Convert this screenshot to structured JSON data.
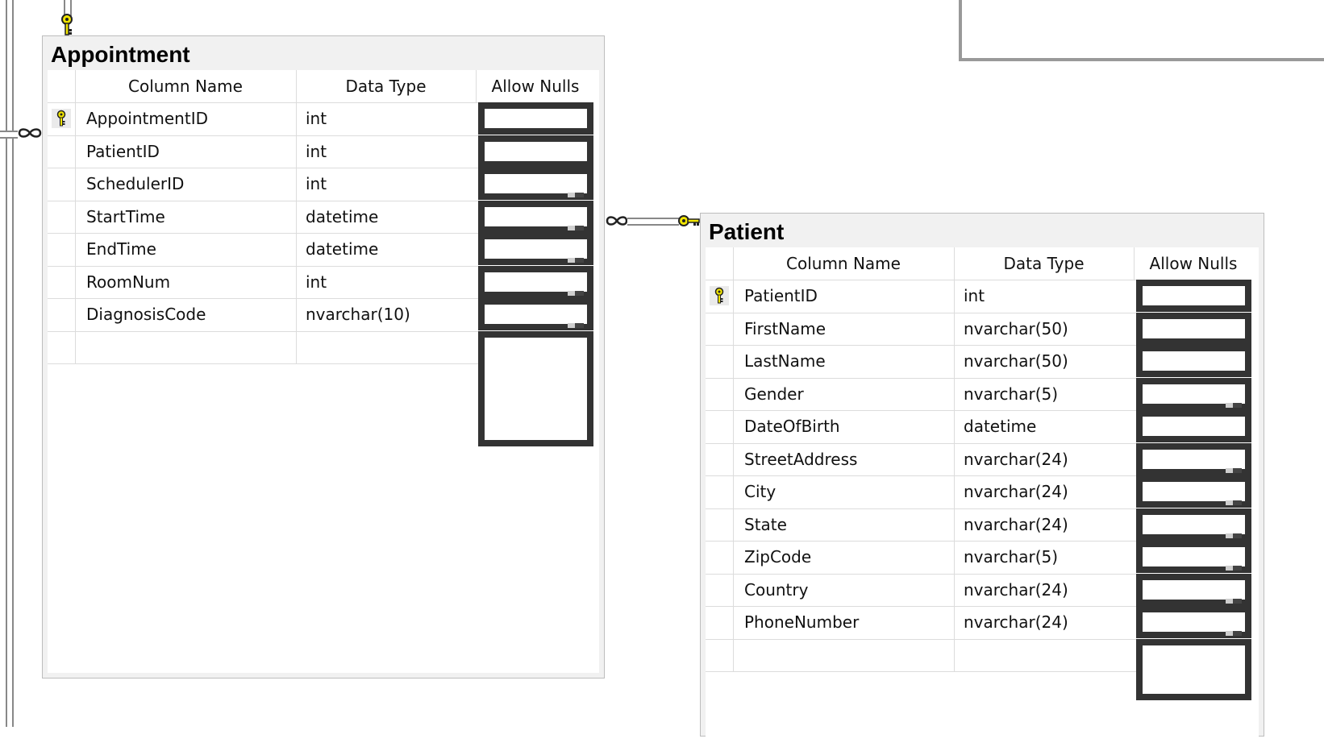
{
  "appointment": {
    "title": "Appointment",
    "headers": {
      "column_name": "Column Name",
      "data_type": "Data Type",
      "allow_nulls": "Allow Nulls"
    },
    "rows": [
      {
        "name": "AppointmentID",
        "type": "int",
        "pk": true
      },
      {
        "name": "PatientID",
        "type": "int"
      },
      {
        "name": "SchedulerID",
        "type": "int"
      },
      {
        "name": "StartTime",
        "type": "datetime"
      },
      {
        "name": "EndTime",
        "type": "datetime"
      },
      {
        "name": "RoomNum",
        "type": "int"
      },
      {
        "name": "DiagnosisCode",
        "type": "nvarchar(10)"
      }
    ]
  },
  "patient": {
    "title": "Patient",
    "headers": {
      "column_name": "Column Name",
      "data_type": "Data Type",
      "allow_nulls": "Allow Nulls"
    },
    "rows": [
      {
        "name": "PatientID",
        "type": "int",
        "pk": true
      },
      {
        "name": "FirstName",
        "type": "nvarchar(50)"
      },
      {
        "name": "LastName",
        "type": "nvarchar(50)"
      },
      {
        "name": "Gender",
        "type": "nvarchar(5)"
      },
      {
        "name": "DateOfBirth",
        "type": "datetime"
      },
      {
        "name": "StreetAddress",
        "type": "nvarchar(24)"
      },
      {
        "name": "City",
        "type": "nvarchar(24)"
      },
      {
        "name": "State",
        "type": "nvarchar(24)"
      },
      {
        "name": "ZipCode",
        "type": "nvarchar(5)"
      },
      {
        "name": "Country",
        "type": "nvarchar(24)"
      },
      {
        "name": "PhoneNumber",
        "type": "nvarchar(24)"
      }
    ]
  },
  "icons": {
    "primary_key": "key-icon",
    "relationship_many": "infinity-icon"
  },
  "colors": {
    "key_yellow": "#f2e600",
    "checkbox_border": "#333333",
    "frame_gray": "#f1f1f1"
  }
}
